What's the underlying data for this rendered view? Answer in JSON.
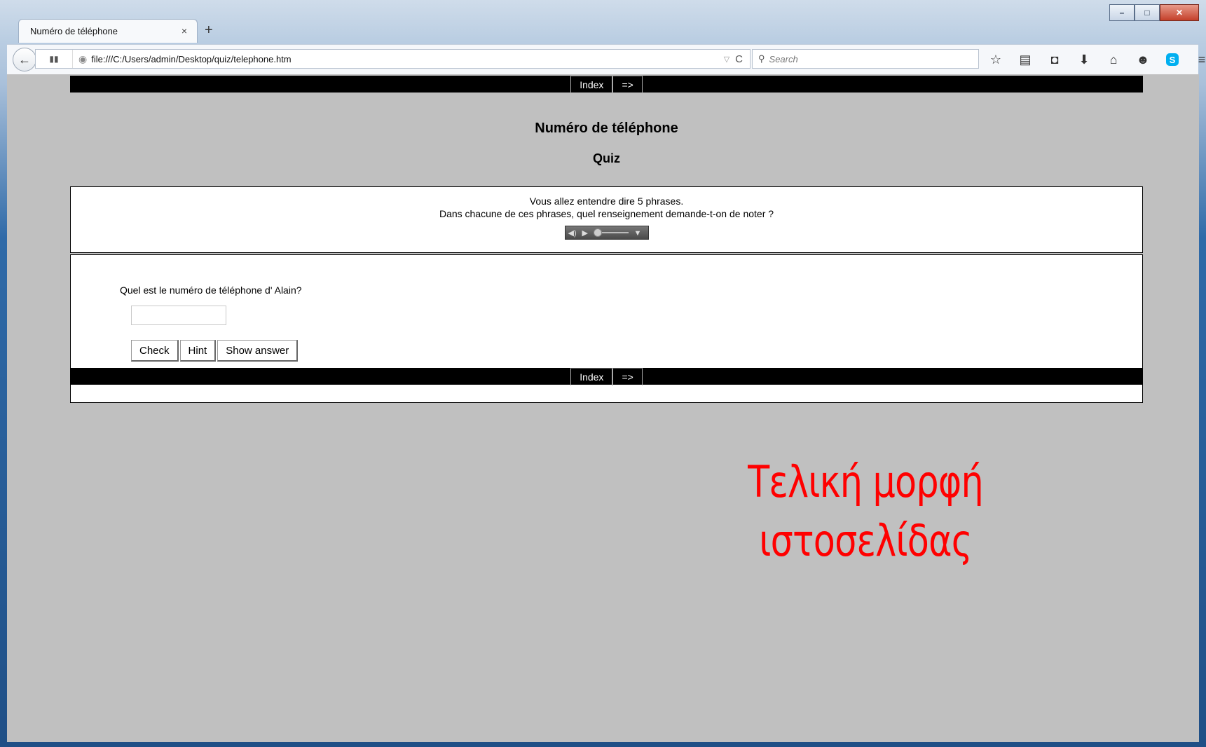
{
  "window": {
    "minimize_label": "–",
    "maximize_label": "□",
    "close_label": "✕"
  },
  "tab": {
    "title": "Numéro de téléphone",
    "close_label": "×",
    "new_tab_label": "+"
  },
  "navbar": {
    "back_label": "←",
    "identity_label": "▮▮",
    "url": "file:///C:/Users/admin/Desktop/quiz/telephone.htm",
    "dropdown_label": "▽",
    "reload_label": "C",
    "search_placeholder": "Search",
    "icons": [
      "bookmark-star-icon",
      "reading-list-icon",
      "pocket-icon",
      "download-icon",
      "home-icon",
      "chat-icon",
      "skype-icon",
      "menu-icon"
    ]
  },
  "page": {
    "nav_index_label": "Index",
    "nav_next_label": "=>",
    "title": "Numéro de téléphone",
    "subtitle": "Quiz",
    "instruction_line1": "Vous allez entendre dire 5 phrases.",
    "instruction_line2": "Dans chacune de ces phrases, quel renseignement demande-t-on de noter ?",
    "question": "Quel est le numéro de téléphone d' Alain?",
    "answer_value": "",
    "buttons": {
      "check": "Check",
      "hint": "Hint",
      "show_answer": "Show answer"
    }
  },
  "overlay": {
    "line1": "Τελική μορφή",
    "line2": "ιστοσελίδας",
    "color": "#ff0000"
  }
}
